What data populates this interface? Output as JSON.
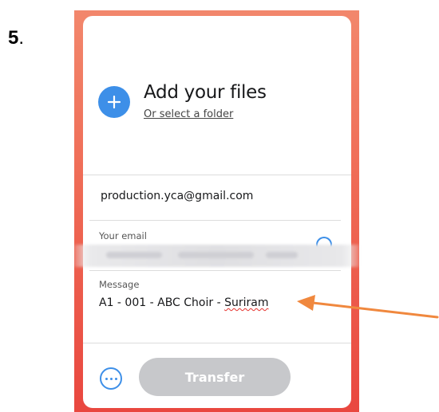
{
  "step": {
    "number": "5",
    "suffix": "."
  },
  "upload": {
    "title": "Add your files",
    "folder_link": "Or select a folder"
  },
  "form": {
    "to_email": "production.yca@gmail.com",
    "your_email_label": "Your email",
    "message_label": "Message",
    "message_value_prefix": "A1 - 001 - ABC Choir - ",
    "message_value_flagged": "Suriram"
  },
  "actions": {
    "transfer_label": "Transfer"
  },
  "colors": {
    "frame_top": "#f2876c",
    "frame_bottom": "#e9473f",
    "accent_blue": "#3d8fe8",
    "transfer_disabled": "#c7c8cb",
    "annotation_arrow": "#f0883e"
  },
  "icons": {
    "add": "plus-icon",
    "options": "more-horizontal-icon",
    "verify": "spinner-icon",
    "annotation": "arrow-left-icon"
  }
}
